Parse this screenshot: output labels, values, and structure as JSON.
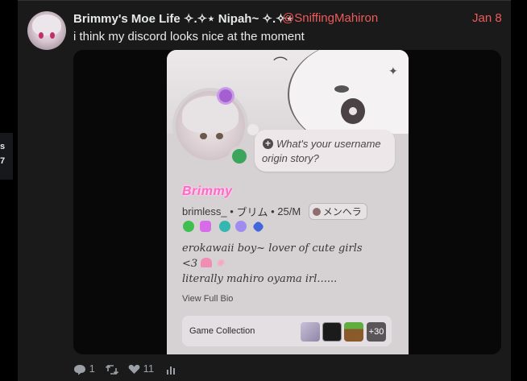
{
  "left_strip": {
    "lines": [
      "s",
      "7"
    ]
  },
  "post": {
    "author_name": "Brimmy's Moe Life ✧.✧⋆ Nipah~ ✧.✧⋆",
    "handle": "@SniffingMahiron",
    "date": "Jan 8",
    "text": "i think my discord looks nice at the moment"
  },
  "discord_card": {
    "bubble_text": "What's your username origin story?",
    "display_name": "Brimmy",
    "username": "brimless_",
    "separator": "•",
    "nickname": "ブリム",
    "age_gender": "25/M",
    "tag": "メンヘラ",
    "bio_lines": [
      "erokawaii boy~ lover of cute girls",
      "<3",
      "literally mahiro oyama irl......"
    ],
    "view_full_bio": "View Full Bio",
    "game_collection_label": "Game Collection",
    "game_extra": "+30"
  },
  "actions": {
    "replies": "1",
    "likes": "11"
  },
  "colors": {
    "accent_red": "#f05a5a",
    "display_name_pink": "#ff69c5",
    "status_online": "#3ba55c"
  }
}
